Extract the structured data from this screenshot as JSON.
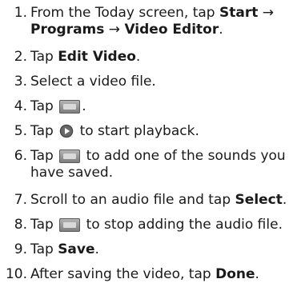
{
  "steps": [
    {
      "num": "1.",
      "a": "From the Today screen, tap ",
      "b1": "Start",
      "c": " →",
      "line2_b1": "Programs",
      "line2_c": " → ",
      "line2_b2": "Video Editor",
      "line2_d": "."
    },
    {
      "num": "2.",
      "a": "Tap ",
      "b1": "Edit Video",
      "c": "."
    },
    {
      "num": "3.",
      "a": "Select a video file."
    },
    {
      "num": "4.",
      "a": "Tap ",
      "icon": "audio-track-icon",
      "c": "."
    },
    {
      "num": "5.",
      "a": "Tap ",
      "icon": "play-icon",
      "c": " to start playback."
    },
    {
      "num": "6.",
      "a": "Tap ",
      "icon": "add-sound-icon",
      "c": " to add one of the sounds you",
      "line2": "have saved."
    },
    {
      "num": "7.",
      "a": "Scroll to an audio file and tap ",
      "b1": "Select",
      "c": "."
    },
    {
      "num": "8.",
      "a": "Tap ",
      "icon": "stop-adding-audio-icon",
      "c": " to stop adding the audio file."
    },
    {
      "num": "9.",
      "a": "Tap ",
      "b1": "Save",
      "c": "."
    },
    {
      "num": "10.",
      "a": "After saving the video, tap ",
      "b1": "Done",
      "c": "."
    }
  ],
  "colors": {
    "text": "#1a1a1a",
    "icon_gray": "#8a8a8a",
    "play_circle": "#4a4a4a"
  }
}
